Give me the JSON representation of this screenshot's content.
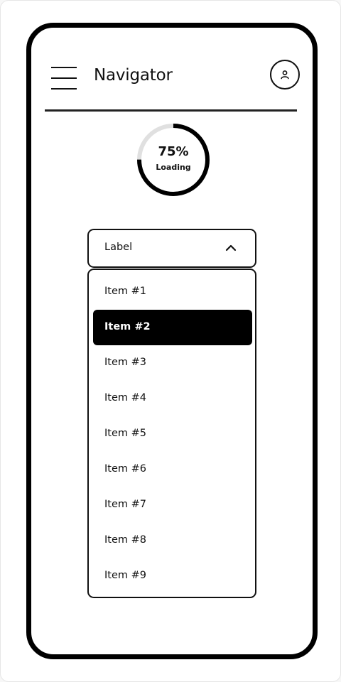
{
  "header": {
    "title": "Navigator",
    "menu_icon": "hamburger-menu-icon",
    "profile_icon": "user-icon"
  },
  "progress": {
    "value": 0.75,
    "value_text": "75%",
    "label": "Loading",
    "color": "#000000",
    "track_color": "#e0e0e0"
  },
  "dropdown": {
    "label": "Label",
    "state": "expanded",
    "chevron_icon": "chevron-up-icon",
    "selected_index": 1,
    "items": [
      {
        "label": "Item #1"
      },
      {
        "label": "Item #2"
      },
      {
        "label": "Item #3"
      },
      {
        "label": "Item #4"
      },
      {
        "label": "Item #5"
      },
      {
        "label": "Item #6"
      },
      {
        "label": "Item #7"
      },
      {
        "label": "Item #8"
      },
      {
        "label": "Item #9"
      }
    ]
  }
}
